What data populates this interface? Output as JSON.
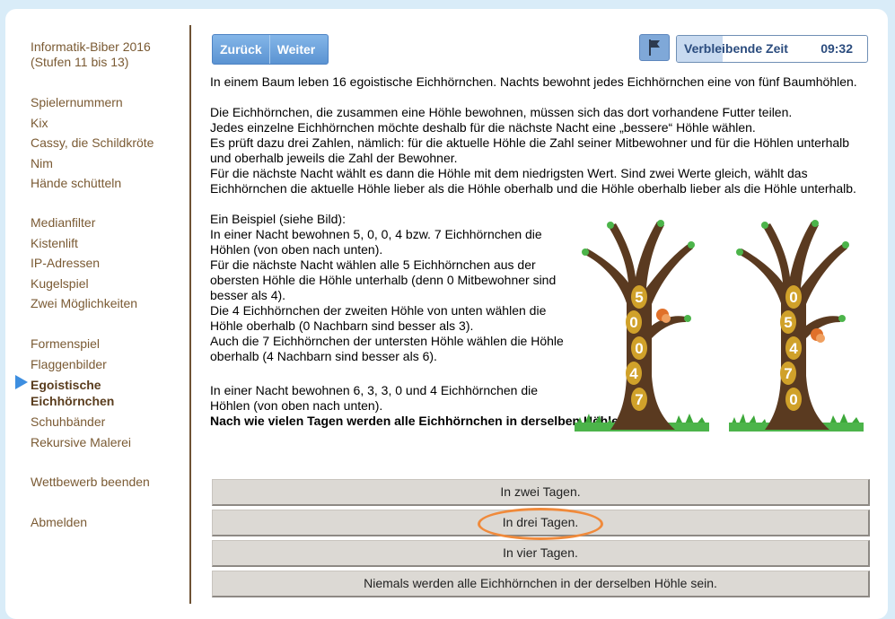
{
  "sidebar": {
    "title": [
      "Informatik-Biber 2016",
      "(Stufen 11 bis 13)"
    ],
    "group1": [
      "Spielernummern",
      "Kix",
      "Cassy, die Schildkröte",
      "Nim",
      "Hände schütteln"
    ],
    "group2": [
      "Medianfilter",
      "Kistenlift",
      "IP-Adressen",
      "Kugelspiel",
      "Zwei Möglichkeiten"
    ],
    "group3_before": [
      "Formenspiel",
      "Flaggenbilder"
    ],
    "active": [
      "Egoistische",
      "Eichhörnchen"
    ],
    "group3_after": [
      "Schuhbänder",
      "Rekursive Malerei"
    ],
    "end": "Wettbewerb beenden",
    "logout": "Abmelden"
  },
  "nav": {
    "back": "Zurück",
    "next": "Weiter"
  },
  "timer": {
    "label": "Verbleibende Zeit",
    "value": "09:32",
    "remaining_fraction": 0.24
  },
  "task": {
    "intro": "In einem Baum leben 16 egoistische Eichhörnchen. Nachts bewohnt jedes Eichhörnchen eine von fünf Baumhöhlen.",
    "rules": [
      "Die Eichhörnchen, die zusammen eine Höhle bewohnen, müssen sich das dort vorhandene Futter teilen.",
      "Jedes einzelne Eichhörnchen möchte deshalb für die nächste Nacht eine „bessere“ Höhle wählen.",
      "Es prüft dazu drei Zahlen, nämlich: für die aktuelle Höhle die Zahl seiner Mitbewohner und für die Höhlen unterhalb und oberhalb jeweils die Zahl der Bewohner.",
      "Für die nächste Nacht wählt es dann die Höhle mit dem niedrigsten Wert. Sind zwei Werte gleich, wählt das Eichhörnchen die aktuelle Höhle lieber als die Höhle oberhalb und die Höhle oberhalb lieber als die Höhle unterhalb."
    ],
    "example": [
      "Ein Beispiel (siehe Bild):",
      "In einer Nacht bewohnen 5, 0, 0, 4 bzw. 7 Eichhörnchen die Höhlen (von oben nach unten).",
      "Für die nächste Nacht wählen alle 5 Eichhörnchen aus der obersten Höhle die Höhle unterhalb (denn 0 Mitbewohner sind besser als 4).",
      "Die 4 Eichhörnchen der zweiten Höhle von unten wählen die Höhle oberhalb (0 Nachbarn sind besser als 3).",
      "Auch die 7 Eichhörnchen der untersten Höhle wählen die Höhle oberhalb (4 Nachbarn sind besser als 6)."
    ],
    "setup": "In einer Nacht bewohnen 6, 3, 3, 0 und 4 Eichhörnchen die Höhlen (von oben nach unten).",
    "question": "Nach wie vielen Tagen werden alle Eichhörnchen in derselben Höhle sein?"
  },
  "trees": [
    {
      "holes": [
        "5",
        "0",
        "0",
        "4",
        "7"
      ]
    },
    {
      "holes": [
        "0",
        "5",
        "4",
        "7",
        "0"
      ]
    }
  ],
  "answers": [
    "In zwei Tagen.",
    "In drei Tagen.",
    "In vier Tagen.",
    "Niemals werden alle Eichhörnchen in der derselben Höhle sein."
  ],
  "colors": {
    "accent": "#5b93d2",
    "sidebar_text": "#7a5a33",
    "highlight": "#f08a3b",
    "arrow": "#3d8ee0"
  }
}
